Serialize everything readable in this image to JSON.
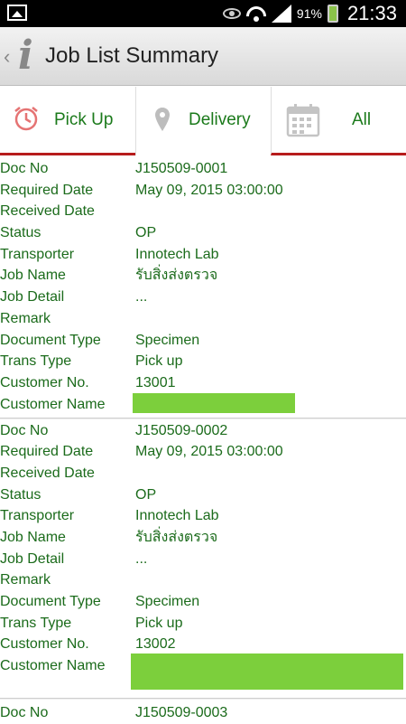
{
  "status_bar": {
    "battery_percent": "91%",
    "time": "21:33",
    "icons": [
      "image-icon",
      "eye-icon",
      "wifi-icon",
      "signal-icon",
      "battery-charging-icon"
    ]
  },
  "action_bar": {
    "title": "Job List Summary",
    "icons": [
      "back-chevron-icon",
      "app-info-icon"
    ]
  },
  "tabs": [
    {
      "label": "Pick Up",
      "icon": "alarm-clock-icon",
      "selected": true
    },
    {
      "label": "Delivery",
      "icon": "map-pin-icon",
      "selected": false
    },
    {
      "label": "All",
      "icon": "calendar-icon",
      "selected": false
    }
  ],
  "colors": {
    "text_green": "#1b6b1b",
    "tab_indicator": "#b71c1c",
    "redaction": "#7ccf3c"
  },
  "labels": {
    "doc_no": "Doc No",
    "required_date": "Required Date",
    "received_date": "Received Date",
    "status": "Status",
    "transporter": "Transporter",
    "job_name": "Job Name",
    "job_detail": "Job Detail",
    "remark": "Remark",
    "document_type": "Document Type",
    "trans_type": "Trans Type",
    "customer_no": "Customer No.",
    "customer_name": "Customer Name"
  },
  "jobs": [
    {
      "doc_no": "J150509-0001",
      "required_date": "May 09, 2015 03:00:00",
      "received_date": "",
      "status": "OP",
      "transporter": "Innotech Lab",
      "job_name": "รับสิ่งส่งตรวจ",
      "job_detail": "...",
      "remark": "",
      "document_type": "Specimen",
      "trans_type": "Pick up",
      "customer_no": "13001",
      "customer_name": ""
    },
    {
      "doc_no": "J150509-0002",
      "required_date": "May 09, 2015 03:00:00",
      "received_date": "",
      "status": "OP",
      "transporter": "Innotech Lab",
      "job_name": "รับสิ่งส่งตรวจ",
      "job_detail": "...",
      "remark": "",
      "document_type": "Specimen",
      "trans_type": "Pick up",
      "customer_no": "13002",
      "customer_name": ""
    },
    {
      "doc_no": "J150509-0003"
    }
  ]
}
